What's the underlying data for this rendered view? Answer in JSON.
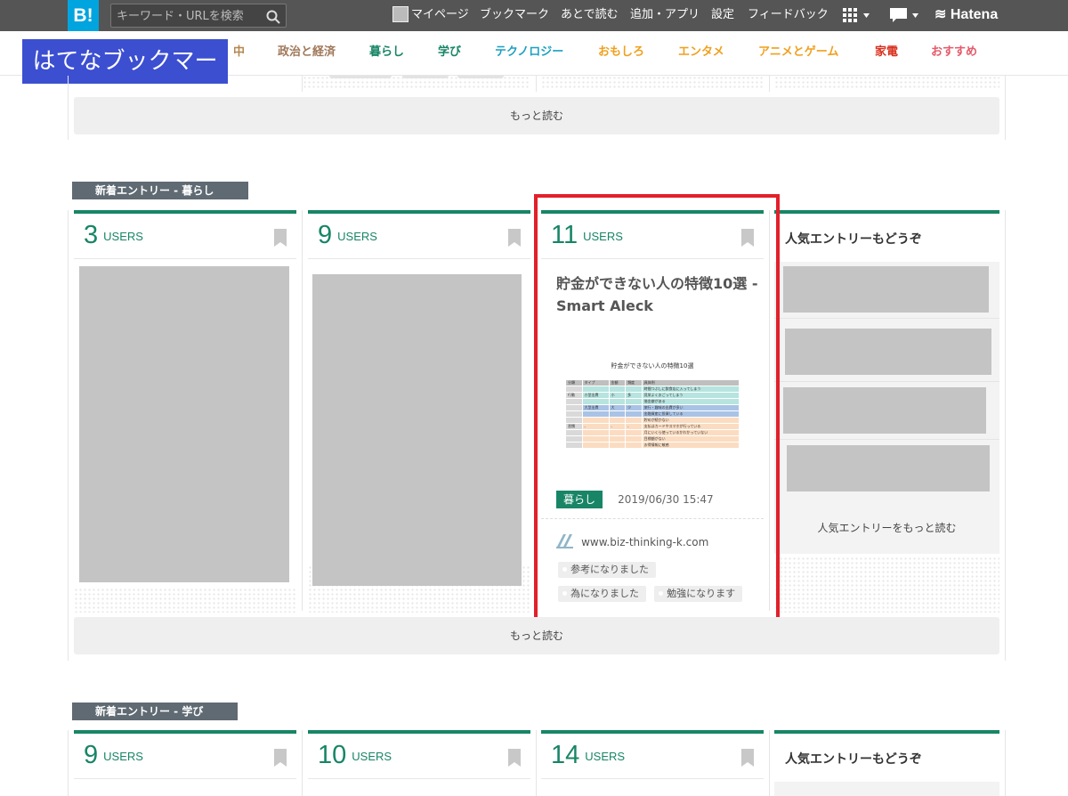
{
  "topbar": {
    "logo": "B!",
    "search_placeholder": "キーワード・URLを検索",
    "nav": [
      "マイページ",
      "ブックマーク",
      "あとで読む",
      "追加・アプリ",
      "設定",
      "フィードバック"
    ],
    "hatena": "Hatena"
  },
  "brand": "はてなブックマーク",
  "categories": [
    {
      "label": "中",
      "color": "#b5874f"
    },
    {
      "label": "政治と経済",
      "color": "#a0785a"
    },
    {
      "label": "暮らし",
      "color": "#188566"
    },
    {
      "label": "学び",
      "color": "#188566"
    },
    {
      "label": "テクノロジー",
      "color": "#1ca1c1"
    },
    {
      "label": "おもしろ",
      "color": "#f0a01e"
    },
    {
      "label": "エンタメ",
      "color": "#f0a01e"
    },
    {
      "label": "アニメとゲーム",
      "color": "#f0a01e"
    },
    {
      "label": "家電",
      "color": "#d9301e"
    },
    {
      "label": "おすすめ",
      "color": "#e55a6a"
    }
  ],
  "more_label": "もっと読む",
  "section_kurashi": {
    "label": "新着エントリー - 暮らし",
    "cards": [
      {
        "count": "3",
        "users": "USERS"
      },
      {
        "count": "9",
        "users": "USERS"
      },
      {
        "count": "11",
        "users": "USERS",
        "title": "貯金ができない人の特徴10選 - Smart Aleck",
        "thumb_title": "貯金ができない人の特徴10選",
        "thumb_headers": [
          "分類",
          "タイプ",
          "金額",
          "頻度",
          "具体例"
        ],
        "thumb_rows": [
          [
            "",
            "",
            "",
            "",
            "時間つぶしに飲食店に入ってしまう"
          ],
          [
            "行動",
            "小型出費",
            "小",
            "多",
            "見栄よくおごってしまう"
          ],
          [
            "",
            "",
            "",
            "",
            "借金癖がある"
          ],
          [
            "",
            "大型出費",
            "大",
            "少",
            "旅行・趣味の出費が多い"
          ],
          [
            "",
            "",
            "",
            "",
            "金融資産に投資している"
          ],
          [
            "",
            "",
            "",
            "",
            "貯めが続かない"
          ],
          [
            "習慣",
            "-",
            "-",
            "-",
            "支払はカードやスマホが行っている"
          ],
          [
            "",
            "",
            "",
            "",
            "月にいくら使っているかわかっていない"
          ],
          [
            "",
            "",
            "",
            "",
            "目標額がない"
          ],
          [
            "",
            "",
            "",
            "",
            "お得情報に敏感"
          ]
        ],
        "category_tag": "暮らし",
        "date": "2019/06/30 15:47",
        "domain": "www.biz-thinking-k.com",
        "comments": [
          "参考になりました",
          "為になりました",
          "勉強になります"
        ]
      }
    ],
    "popular_title": "人気エントリーもどうぞ",
    "popular_more": "人気エントリーをもっと読む"
  },
  "section_manabi": {
    "label": "新着エントリー - 学び",
    "cards": [
      {
        "count": "9",
        "users": "USERS"
      },
      {
        "count": "10",
        "users": "USERS"
      },
      {
        "count": "14",
        "users": "USERS"
      }
    ],
    "popular_title": "人気エントリーもどうぞ"
  },
  "colors": {
    "accent": "#188566",
    "topbar": "#555555",
    "brand": "#3c4fd1",
    "highlight": "#e2202a"
  }
}
